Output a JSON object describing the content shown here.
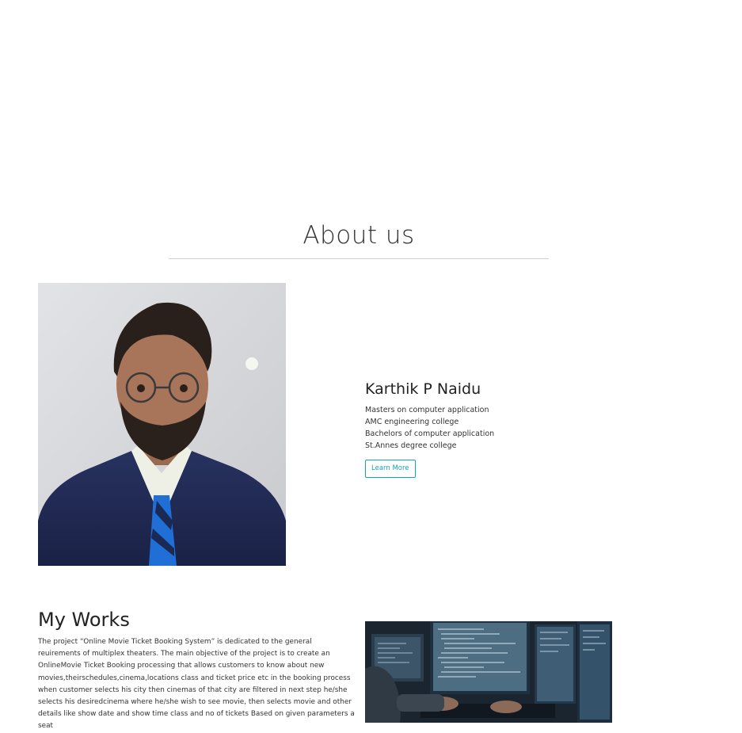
{
  "about": {
    "title": "About us"
  },
  "profile": {
    "name": "Karthik P Naidu",
    "lines": [
      "Masters on computer application",
      "AMC engineering college",
      "Bachelors of computer application",
      "St.Annes degree college"
    ],
    "button_label": "Learn More"
  },
  "works": {
    "title": "My Works",
    "description": "The project “Online Movie Ticket Booking System” is dedicated to the general reuirements of multiplex theaters. The main objective of the project is to create an OnlineMovie Ticket Booking processing that allows customers to know about new movies,theirschedules,cinema,locations class and ticket price etc in the booking process when customer selects his city then cinemas of that city are filtered in next step he/she selects his desiredcinema where he/she wish to see movie, then selects movie and other details like show date and show time class and no of tickets Based on given parameters a seat"
  },
  "colors": {
    "accent": "#17a2b8",
    "rule": "#cfcfcf",
    "text": "#212529"
  }
}
